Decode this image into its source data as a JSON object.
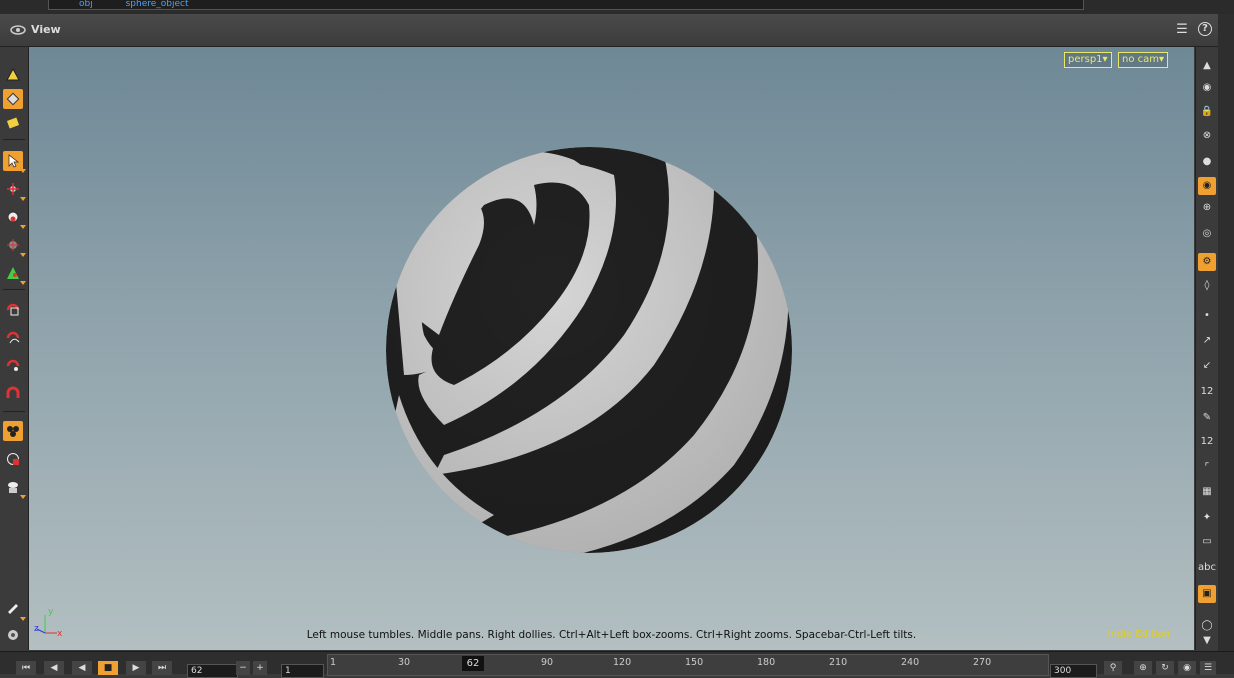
{
  "path": {
    "segment1": "obj",
    "segment2": "sphere_object"
  },
  "pane": {
    "title": "View",
    "help_label": "?"
  },
  "camera": {
    "persp_label": "persp1▾",
    "cam_label": "no cam▾"
  },
  "viewport": {
    "hint": "Left mouse tumbles. Middle pans. Right dollies. Ctrl+Alt+Left box-zooms. Ctrl+Right zooms. Spacebar-Ctrl-Left tilts.",
    "edition": "Indie Edition",
    "axes": {
      "x": "x",
      "y": "y",
      "z": "z"
    },
    "background_top": "#6e8896",
    "background_bottom": "#b3bfc1"
  },
  "right_toolbar": {
    "point_num_label": "12",
    "prim_num_label": "12",
    "text_label": "abc"
  },
  "timeline": {
    "current_frame": "62",
    "frame_field": "62",
    "start_field": "1",
    "end_field": "300",
    "ticks": [
      "1",
      "30",
      "62",
      "90",
      "120",
      "150",
      "180",
      "210",
      "240",
      "270"
    ]
  },
  "colors": {
    "accent": "#f0a030",
    "hud_yellow": "#e8e86a",
    "indie_yellow": "#e0d020"
  }
}
